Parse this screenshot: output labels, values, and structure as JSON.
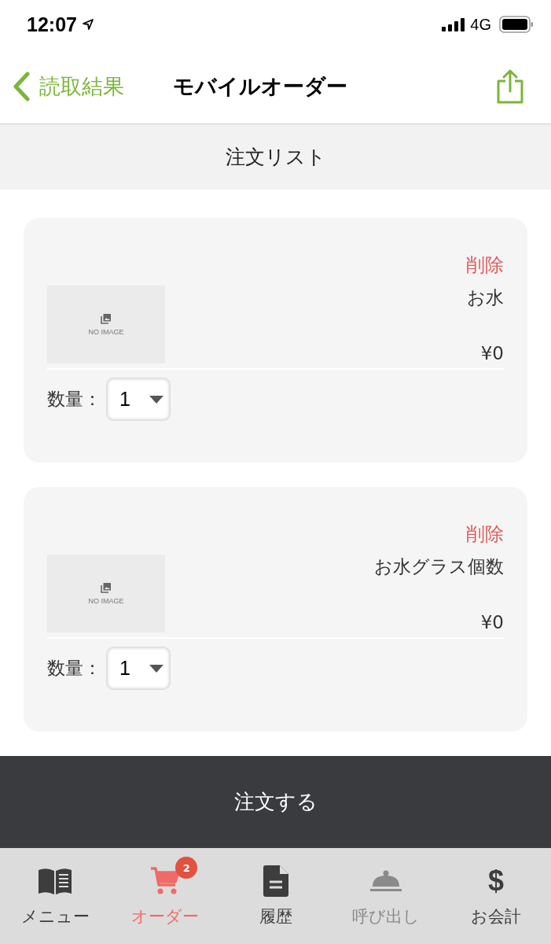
{
  "status_bar": {
    "time": "12:07",
    "network": "4G"
  },
  "nav": {
    "back_label": "読取結果",
    "title": "モバイルオーダー"
  },
  "section_header": "注文リスト",
  "items": [
    {
      "delete_label": "削除",
      "name": "お水",
      "price": "¥0",
      "image_text": "NO IMAGE",
      "quantity_label": "数量：",
      "quantity": "1"
    },
    {
      "delete_label": "削除",
      "name": "お水グラス個数",
      "price": "¥0",
      "image_text": "NO IMAGE",
      "quantity_label": "数量：",
      "quantity": "1"
    }
  ],
  "order_button": "注文する",
  "tabs": [
    {
      "kind": "book",
      "label": "メニュー",
      "selected": false,
      "disabled": false
    },
    {
      "kind": "cart",
      "label": "オーダー",
      "selected": true,
      "disabled": false,
      "badge": "2"
    },
    {
      "kind": "document",
      "label": "履歴",
      "selected": false,
      "disabled": false
    },
    {
      "kind": "cloche",
      "label": "呼び出し",
      "selected": false,
      "disabled": true
    },
    {
      "kind": "char",
      "icon": "$",
      "label": "お会計",
      "selected": false,
      "disabled": false
    }
  ]
}
